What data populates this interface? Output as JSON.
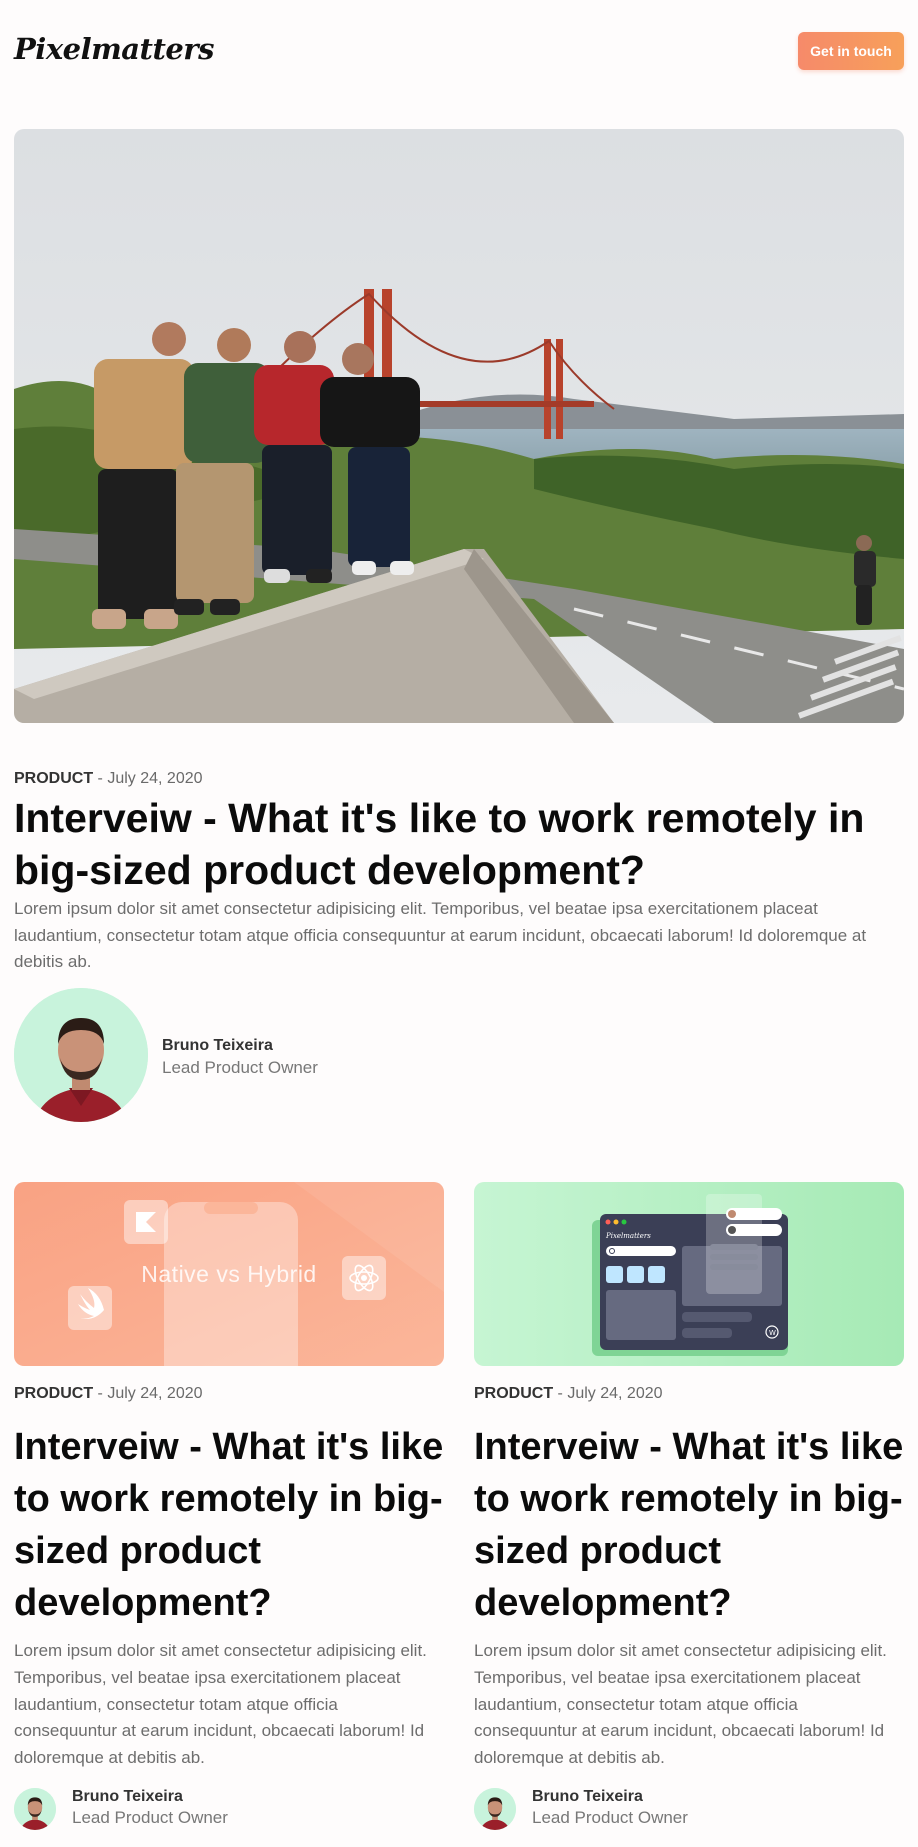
{
  "header": {
    "logo": "Pixelmatters",
    "cta_label": "Get in touch"
  },
  "featured": {
    "category": "PRODUCT",
    "separator": " - ",
    "date": "July 24, 2020",
    "title": "Interveiw - What it's like to work remotely in big-sized product development?",
    "excerpt": "Lorem ipsum dolor sit amet consectetur adipisicing elit. Temporibus, vel beatae ipsa exercitationem placeat laudantium, consectetur totam atque officia consequuntur at earum incidunt, obcaecati laborum! Id doloremque at debitis ab.",
    "author": {
      "name": "Bruno Teixeira",
      "role": "Lead Product Owner"
    }
  },
  "posts": [
    {
      "image_label": "Native vs Hybrid",
      "category": "PRODUCT",
      "separator": " - ",
      "date": "July 24, 2020",
      "title": "Interveiw - What it's like to work remotely in big-sized product development?",
      "excerpt": "Lorem ipsum dolor sit amet consectetur adipisicing elit. Temporibus, vel beatae ipsa exercitationem placeat laudantium, consectetur totam atque officia consequuntur at earum incidunt, obcaecati laborum! Id doloremque at debitis ab.",
      "author": {
        "name": "Bruno Teixeira",
        "role": "Lead Product Owner"
      }
    },
    {
      "image_label": "Pixelmatters",
      "category": "PRODUCT",
      "separator": " - ",
      "date": "July 24, 2020",
      "title": "Interveiw - What it's like to work remotely in big-sized product development?",
      "excerpt": "Lorem ipsum dolor sit amet consectetur adipisicing elit. Temporibus, vel beatae ipsa exercitationem placeat laudantium, consectetur totam atque officia consequuntur at earum incidunt, obcaecati laborum! Id doloremque at debitis ab.",
      "author": {
        "name": "Bruno Teixeira",
        "role": "Lead Product Owner"
      }
    }
  ],
  "colors": {
    "accent_gradient_start": "#f68a6a",
    "accent_gradient_end": "#f7a05a",
    "card_orange": "#fbab90",
    "card_green": "#b3f0c5",
    "avatar_bg": "#c8f3dc"
  },
  "icons": [
    "kotlin-icon",
    "swift-icon",
    "react-icon",
    "wordpress-icon",
    "search-icon"
  ]
}
